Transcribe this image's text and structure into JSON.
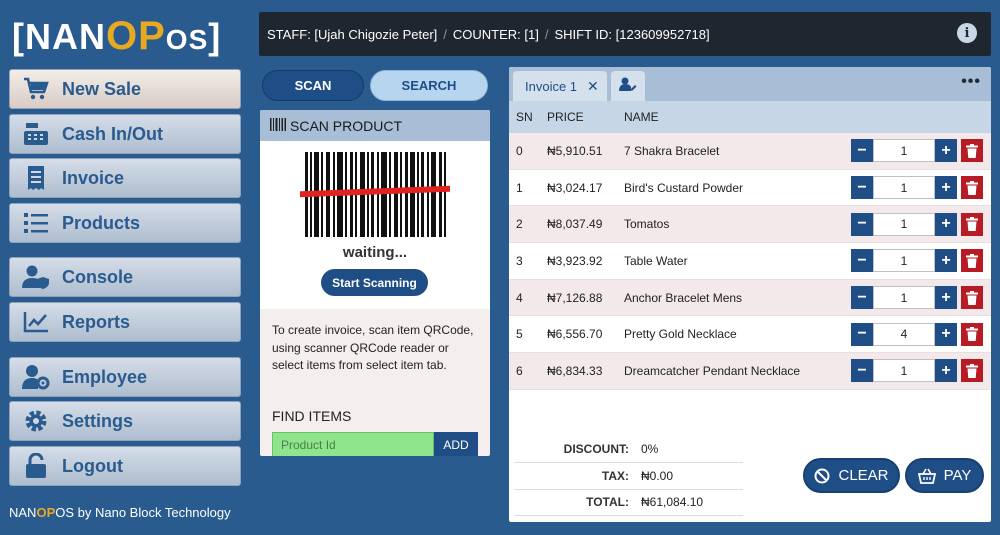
{
  "logo": {
    "left_bracket": "[",
    "nan": "NAN",
    "op": "OP",
    "os": "OS",
    "right_bracket": "]"
  },
  "menu": [
    {
      "label": "New Sale",
      "icon": "cart-icon"
    },
    {
      "label": "Cash In/Out",
      "icon": "cash-register-icon"
    },
    {
      "label": "Invoice",
      "icon": "receipt-icon"
    },
    {
      "label": "Products",
      "icon": "list-icon"
    },
    {
      "label": "Console",
      "icon": "user-shield-icon"
    },
    {
      "label": "Reports",
      "icon": "chart-line-icon"
    },
    {
      "label": "Employee",
      "icon": "user-gear-icon"
    },
    {
      "label": "Settings",
      "icon": "gear-icon"
    },
    {
      "label": "Logout",
      "icon": "unlock-icon"
    }
  ],
  "footer": {
    "pre": "NAN",
    "op": "OP",
    "post": "OS by Nano Block Technology"
  },
  "header": {
    "staff": "STAFF: [Ujah Chigozie Peter]",
    "counter": "COUNTER: [1]",
    "shift": "SHIFT ID: [123609952718]",
    "separator": "/"
  },
  "scan": {
    "tab_scan": "SCAN",
    "tab_search": "SEARCH",
    "title": "SCAN PRODUCT",
    "status": "waiting...",
    "start_button": "Start Scanning",
    "help": "To create invoice, scan item QRCode, using scanner QRCode reader or select items from select item tab.",
    "find_label": "FIND ITEMS",
    "product_placeholder": "Product Id",
    "add_button": "ADD"
  },
  "invoice": {
    "tab_label": "Invoice 1",
    "close_symbol": "✕",
    "more_symbol": "•••",
    "columns": {
      "sn": "SN",
      "price": "PRICE",
      "name": "NAME"
    },
    "rows": [
      {
        "sn": "0",
        "price": "₦5,910.51",
        "name": "7 Shakra Bracelet",
        "qty": "1"
      },
      {
        "sn": "1",
        "price": "₦3,024.17",
        "name": "Bird's Custard Powder",
        "qty": "1"
      },
      {
        "sn": "2",
        "price": "₦8,037.49",
        "name": "Tomatos",
        "qty": "1"
      },
      {
        "sn": "3",
        "price": "₦3,923.92",
        "name": "Table Water",
        "qty": "1"
      },
      {
        "sn": "4",
        "price": "₦7,126.88",
        "name": "Anchor Bracelet Mens",
        "qty": "1"
      },
      {
        "sn": "5",
        "price": "₦6,556.70",
        "name": "Pretty Gold Necklace",
        "qty": "4"
      },
      {
        "sn": "6",
        "price": "₦6,834.33",
        "name": "Dreamcatcher Pendant Necklace",
        "qty": "1"
      }
    ],
    "discount_label": "DISCOUNT:",
    "discount_value": "0%",
    "tax_label": "TAX:",
    "tax_value": "₦0.00",
    "total_label": "TOTAL:",
    "total_value": "₦61,084.10",
    "clear_button": "CLEAR",
    "pay_button": "PAY"
  },
  "colors": {
    "primary": "#1f4e86",
    "sidebar": "#2a5b8f",
    "accent": "#e7a921",
    "danger": "#b71c25",
    "input_green": "#8fe58b"
  }
}
